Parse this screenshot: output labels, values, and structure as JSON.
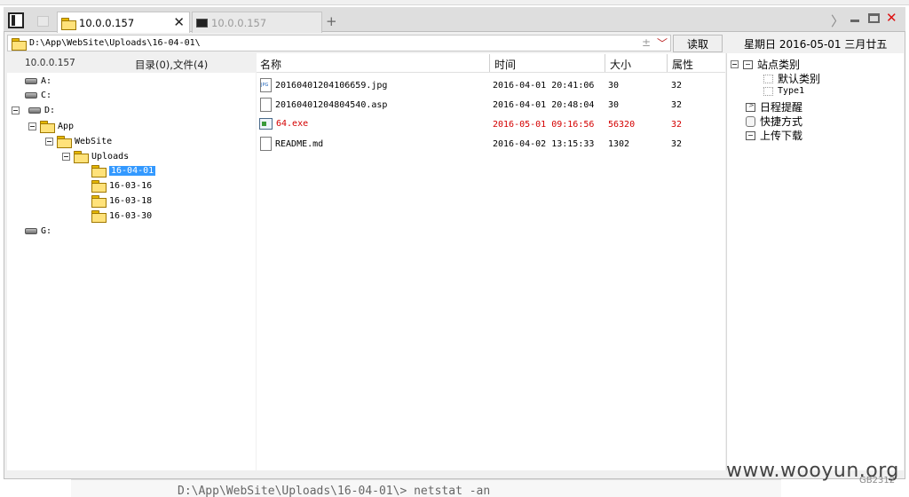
{
  "background": {
    "bottom_text": "D:\\App\\WebSite\\Uploads\\16-04-01\\> netstat -an"
  },
  "tabs": [
    {
      "label": "10.0.0.157",
      "active": true,
      "icon": "folder-icon"
    },
    {
      "label": "10.0.0.157",
      "active": false,
      "icon": "terminal-icon"
    }
  ],
  "toolbar": {
    "new_tab": "+",
    "scroll_right": "〉",
    "close": "✕"
  },
  "address": {
    "path": "D:\\App\\WebSite\\Uploads\\16-04-01\\",
    "plus": "±",
    "dropdown": "﹀",
    "read_button": "读取"
  },
  "status": {
    "host": "10.0.0.157",
    "summary": "目录(0),文件(4)"
  },
  "tree": [
    {
      "label": "A:",
      "type": "drive"
    },
    {
      "label": "C:",
      "type": "drive"
    },
    {
      "label": "D:",
      "type": "drive",
      "expanded": true
    },
    {
      "label": "App",
      "type": "folder",
      "expanded": true
    },
    {
      "label": "WebSite",
      "type": "folder",
      "expanded": true
    },
    {
      "label": "Uploads",
      "type": "folder",
      "expanded": true
    },
    {
      "label": "16-04-01",
      "type": "folder",
      "selected": true
    },
    {
      "label": "16-03-16",
      "type": "folder"
    },
    {
      "label": "16-03-18",
      "type": "folder"
    },
    {
      "label": "16-03-30",
      "type": "folder"
    },
    {
      "label": "G:",
      "type": "drive"
    }
  ],
  "file_list": {
    "columns": [
      "名称",
      "时间",
      "大小",
      "属性"
    ],
    "rows": [
      {
        "name": "20160401204106659.jpg",
        "time": "2016-04-01 20:41:06",
        "size": "30",
        "attr": "32",
        "icon": "jpg-file-icon",
        "highlight": false
      },
      {
        "name": "20160401204804540.asp",
        "time": "2016-04-01 20:48:04",
        "size": "30",
        "attr": "32",
        "icon": "file-icon",
        "highlight": false
      },
      {
        "name": "64.exe",
        "time": "2016-05-01 09:16:56",
        "size": "56320",
        "attr": "32",
        "icon": "exe-file-icon",
        "highlight": true
      },
      {
        "name": "README.md",
        "time": "2016-04-02 13:15:33",
        "size": "1302",
        "attr": "32",
        "icon": "file-icon",
        "highlight": false
      }
    ],
    "highlight_color": "#d40000"
  },
  "right_panel": {
    "date": "星期日 2016-05-01 三月廿五",
    "items": [
      {
        "label": "站点类别",
        "icon": "list-icon"
      },
      {
        "label": "默认类别",
        "icon": "dotted-box-icon"
      },
      {
        "label": "Type1",
        "icon": "dotted-box-icon"
      },
      {
        "label": "日程提醒",
        "icon": "calendar-icon"
      },
      {
        "label": "快捷方式",
        "icon": "hand-icon"
      },
      {
        "label": "上传下载",
        "icon": "list-icon"
      }
    ]
  },
  "footer": {
    "watermark": "www.wooyun.org",
    "encoding": "GB2312"
  },
  "colors": {
    "selection": "#3399ff",
    "tab_bar": "#dedede",
    "window_bg": "#f0f0f0"
  }
}
